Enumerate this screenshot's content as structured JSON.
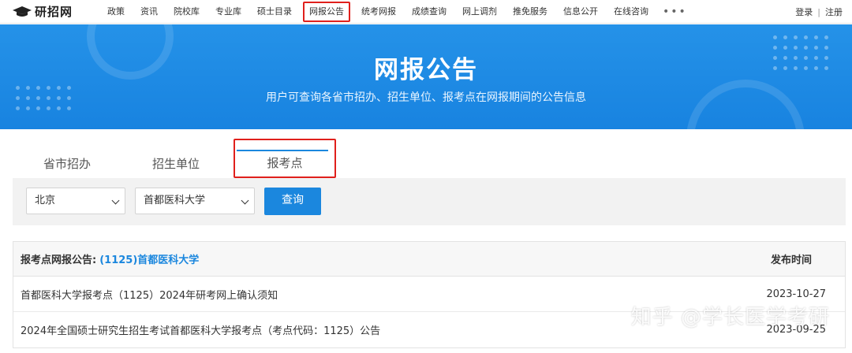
{
  "site": {
    "logo_text": "研招网"
  },
  "nav": {
    "items": [
      "政策",
      "资讯",
      "院校库",
      "专业库",
      "硕士目录",
      "网报公告",
      "统考网报",
      "成绩查询",
      "网上调剂",
      "推免服务",
      "信息公开",
      "在线咨询"
    ],
    "active_index": 5,
    "more": "•••"
  },
  "auth": {
    "login": "登录",
    "separator": "|",
    "register": "注册"
  },
  "banner": {
    "title": "网报公告",
    "subtitle": "用户可查询各省市招办、招生单位、报考点在网报期间的公告信息"
  },
  "tabs": [
    {
      "label": "省市招办"
    },
    {
      "label": "招生单位"
    },
    {
      "label": "报考点"
    }
  ],
  "filter": {
    "province": "北京",
    "site": "首都医科大学",
    "query_label": "查询"
  },
  "table": {
    "header_prefix": "报考点网报公告:",
    "header_school": "(1125)首都医科大学",
    "date_header": "发布时间",
    "rows": [
      {
        "title": "首都医科大学报考点（1125）2024年研考网上确认须知",
        "date": "2023-10-27"
      },
      {
        "title": "2024年全国硕士研究生招生考试首都医科大学报考点（考点代码：1125）公告",
        "date": "2023-09-25"
      }
    ]
  },
  "watermark": "知乎 @学长医学考研",
  "colors": {
    "accent": "#1b87de",
    "highlight": "#e0201c",
    "banner": "#2592e8"
  }
}
